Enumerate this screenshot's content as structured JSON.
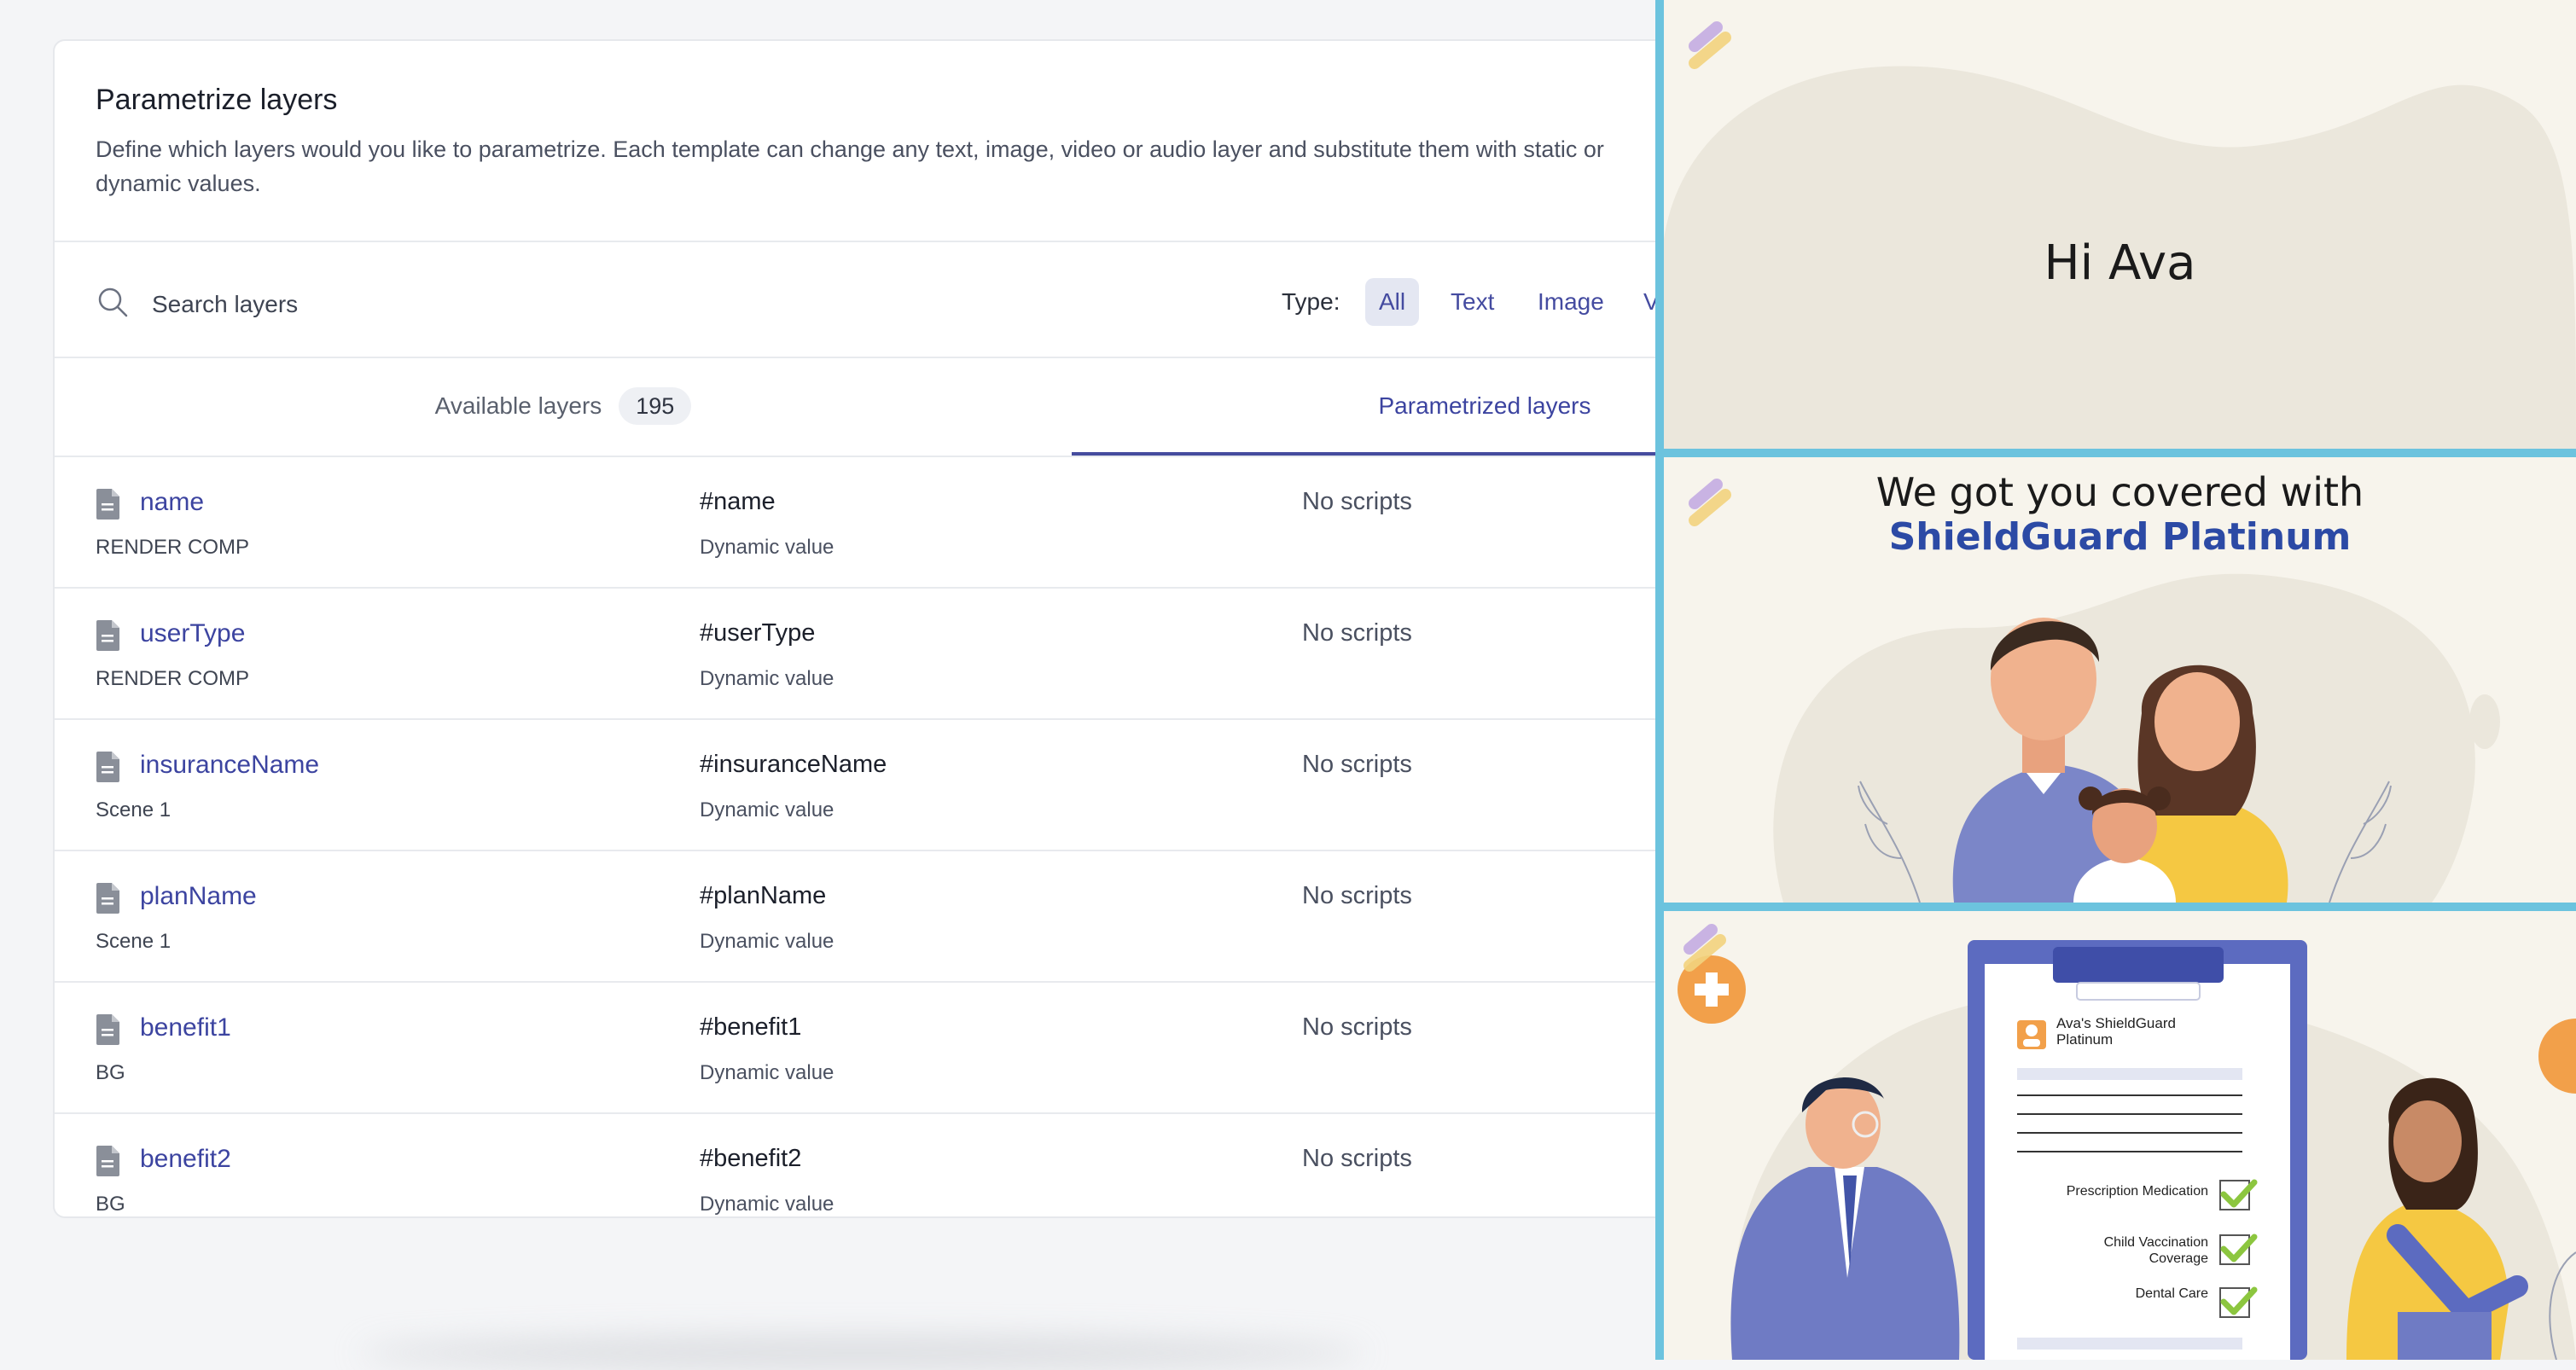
{
  "panel": {
    "title": "Parametrize layers",
    "description": "Define which layers would you like to parametrize. Each template can change any text, image, video or audio layer and substitute them with static or dynamic values."
  },
  "search": {
    "placeholder": "Search layers",
    "icon": "search-icon"
  },
  "type_filter": {
    "label": "Type:",
    "options": [
      "All",
      "Text",
      "Image",
      "Video"
    ],
    "selected": "All"
  },
  "tabs": {
    "available": {
      "label": "Available layers",
      "count": "195"
    },
    "parametrized": {
      "label": "Parametrized layers"
    },
    "active": "parametrized"
  },
  "layers": [
    {
      "name": "name",
      "comp": "RENDER COMP",
      "param": "#name",
      "value_type": "Dynamic value",
      "scripts": "No scripts"
    },
    {
      "name": "userType",
      "comp": "RENDER COMP",
      "param": "#userType",
      "value_type": "Dynamic value",
      "scripts": "No scripts"
    },
    {
      "name": "insuranceName",
      "comp": "Scene 1",
      "param": "#insuranceName",
      "value_type": "Dynamic value",
      "scripts": "No scripts"
    },
    {
      "name": "planName",
      "comp": "Scene 1",
      "param": "#planName",
      "value_type": "Dynamic value",
      "scripts": "No scripts"
    },
    {
      "name": "benefit1",
      "comp": "BG",
      "param": "#benefit1",
      "value_type": "Dynamic value",
      "scripts": "No scripts"
    },
    {
      "name": "benefit2",
      "comp": "BG",
      "param": "#benefit2",
      "value_type": "Dynamic value",
      "scripts": "No scripts"
    }
  ],
  "previews": {
    "frame1": {
      "greeting": "Hi Ava"
    },
    "frame2": {
      "headline": "We got you covered with",
      "plan": "ShieldGuard Platinum"
    },
    "frame3": {
      "doc_title_line1": "Ava's ShieldGuard",
      "doc_title_line2": "Platinum",
      "benefits": [
        "Prescription Medication",
        "Child Vaccination",
        "Coverage",
        "Dental Care"
      ]
    }
  },
  "colors": {
    "accent": "#454c9e",
    "link": "#3c44a0",
    "preview_border": "#6cc3de",
    "plan_blue": "#2c4aa5",
    "illustration_purple": "#7b86c8",
    "illustration_yellow": "#f5c842",
    "check_green": "#8cc63f"
  }
}
